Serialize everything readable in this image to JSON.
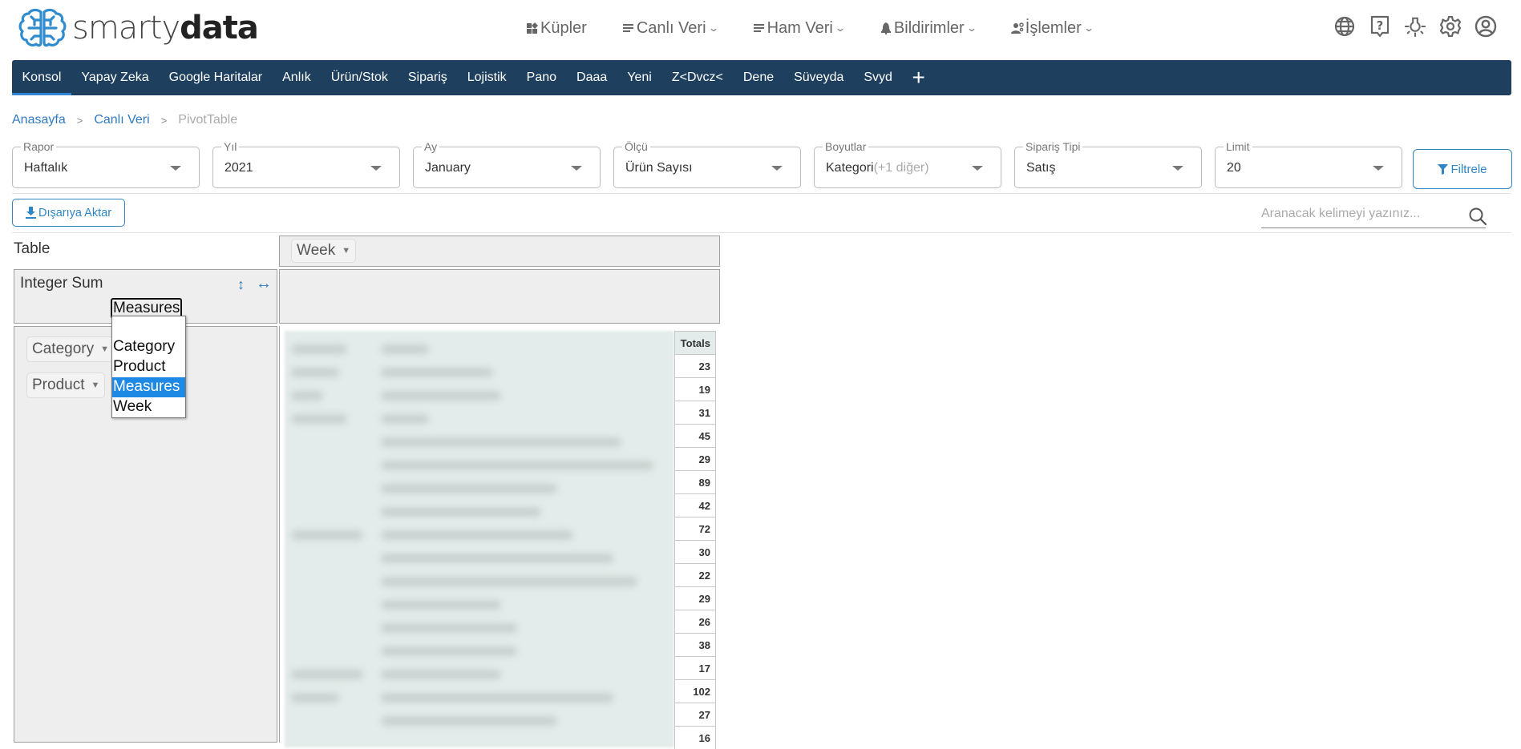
{
  "brand": {
    "light": "smarty",
    "bold": "data",
    "color": "#2e8ccf"
  },
  "topnav": [
    {
      "label": "Küpler",
      "icon": "cubes-icon",
      "dropdown": false
    },
    {
      "label": "Canlı Veri",
      "icon": "list-icon",
      "dropdown": true
    },
    {
      "label": "Ham Veri",
      "icon": "list-icon",
      "dropdown": true
    },
    {
      "label": "Bildirimler",
      "icon": "bell-icon",
      "dropdown": true
    },
    {
      "label": "İşlemler",
      "icon": "users-cog-icon",
      "dropdown": true
    }
  ],
  "top_icons": [
    "globe-icon",
    "help-icon",
    "lightbulb-icon",
    "gear-icon",
    "user-icon"
  ],
  "tabs": [
    {
      "label": "Konsol",
      "active": true
    },
    {
      "label": "Yapay Zeka"
    },
    {
      "label": "Google Haritalar"
    },
    {
      "label": "Anlık"
    },
    {
      "label": "Ürün/Stok"
    },
    {
      "label": "Sipariş"
    },
    {
      "label": "Lojistik"
    },
    {
      "label": "Pano"
    },
    {
      "label": "Daaa"
    },
    {
      "label": "Yeni"
    },
    {
      "label": "Z<Dvcz<"
    },
    {
      "label": "Dene"
    },
    {
      "label": "Süveyda"
    },
    {
      "label": "Svyd"
    }
  ],
  "tab_add_label": "+",
  "breadcrumb": {
    "items": [
      "Anasayfa",
      "Canlı Veri"
    ],
    "current": "PivotTable",
    "separator": ">"
  },
  "filters": [
    {
      "label": "Rapor",
      "value": "Haftalık"
    },
    {
      "label": "Yıl",
      "value": "2021"
    },
    {
      "label": "Ay",
      "value": "January"
    },
    {
      "label": "Ölçü",
      "value": "Ürün Sayısı"
    },
    {
      "label": "Boyutlar",
      "value": "Kategori",
      "more": "(+1 diğer)"
    },
    {
      "label": "Sipariş Tipi",
      "value": "Satış"
    },
    {
      "label": "Limit",
      "value": "20"
    }
  ],
  "filter_button": "Filtrele",
  "export_button": "Dışarıya Aktar",
  "search": {
    "placeholder": "Aranacak kelimeyi yazınız...",
    "value": ""
  },
  "pivot": {
    "renderer": "Table",
    "aggregator": "Integer Sum",
    "sort_icon": "↕",
    "swap_icon": "↔",
    "selected_value_attr": "Measures",
    "col_attrs": [
      {
        "label": "Week"
      }
    ],
    "row_attrs": [
      {
        "label": "Category"
      },
      {
        "label": "Product"
      }
    ],
    "dropdown_options": [
      {
        "label": "Category"
      },
      {
        "label": "Product"
      },
      {
        "label": "Measures",
        "selected": true
      },
      {
        "label": "Week"
      }
    ],
    "totals_header": "Totals",
    "totals": [
      "23",
      "19",
      "31",
      "45",
      "29",
      "89",
      "42",
      "72",
      "30",
      "22",
      "29",
      "26",
      "38",
      "17",
      "102",
      "27",
      "16"
    ]
  }
}
